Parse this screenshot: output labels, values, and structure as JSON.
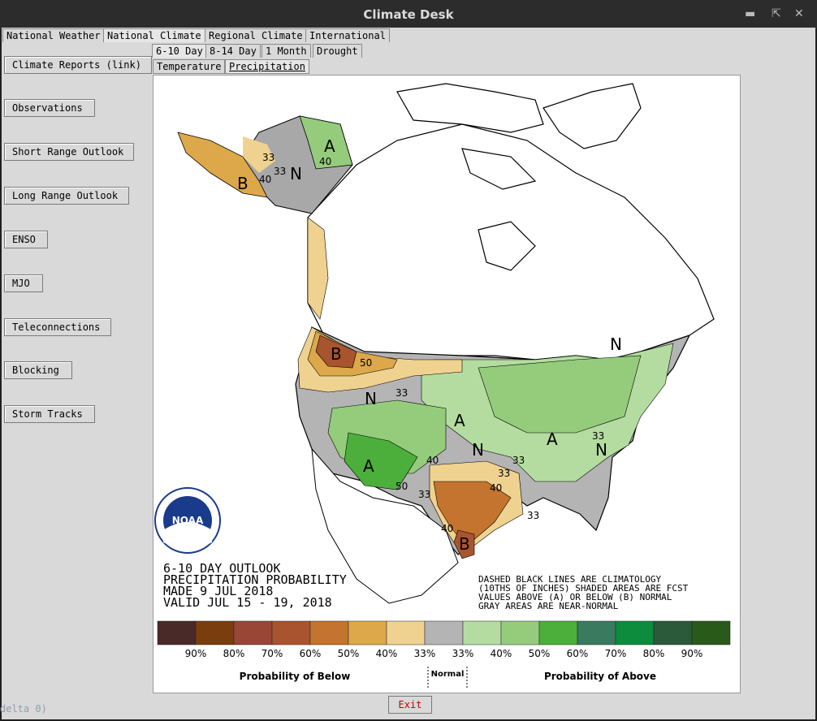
{
  "window": {
    "title": "Climate Desk"
  },
  "tabs": [
    "National Weather",
    "National Climate",
    "Regional Climate",
    "International"
  ],
  "subtabs": [
    "6-10 Day",
    "8-14 Day",
    "1 Month",
    "Drought"
  ],
  "inner_tabs": [
    "Temperature",
    "Precipitation"
  ],
  "sidebar": [
    "Climate Reports (link)",
    "Observations",
    "Short Range Outlook",
    "Long Range Outlook",
    "ENSO",
    "MJO",
    "Teleconnections",
    "Blocking",
    "Storm Tracks"
  ],
  "map": {
    "title_lines": [
      "6-10 DAY OUTLOOK",
      "PRECIPITATION PROBABILITY",
      "MADE   9 JUL 2018",
      "VALID   JUL 15 - 19, 2018"
    ],
    "note_lines": [
      "DASHED BLACK LINES ARE CLIMATOLOGY",
      "(10THS OF INCHES) SHADED AREAS ARE FCST",
      "VALUES ABOVE (A) OR BELOW (B) NORMAL",
      "GRAY AREAS ARE NEAR-NORMAL"
    ],
    "legend_colors": [
      "#4a2a28",
      "#7a3e0e",
      "#9a4636",
      "#a8542e",
      "#c4742e",
      "#dca84a",
      "#f0d290",
      "#b4b4b4",
      "#b4dca0",
      "#94cc7c",
      "#4caf3c",
      "#3a7a5e",
      "#0c8c3c",
      "#2a5a3a",
      "#2a5a1a"
    ],
    "legend_labels": [
      "90%",
      "80%",
      "70%",
      "60%",
      "50%",
      "40%",
      "33%",
      "33%",
      "40%",
      "50%",
      "60%",
      "70%",
      "80%",
      "90%"
    ],
    "prob_below": "Probability of Below",
    "normal": "Normal",
    "prob_above": "Probability of Above",
    "region_letters": [
      "A",
      "N",
      "B",
      "N",
      "A",
      "A",
      "A",
      "N",
      "N",
      "B",
      "N",
      "B"
    ],
    "contour_labels": [
      "33",
      "40",
      "33",
      "40",
      "50",
      "33",
      "33",
      "40",
      "50",
      "33",
      "40",
      "33",
      "33",
      "33",
      "40"
    ],
    "noaa_text": "NOAA"
  },
  "exit_label": "Exit",
  "terminal_text": "delta 0)"
}
